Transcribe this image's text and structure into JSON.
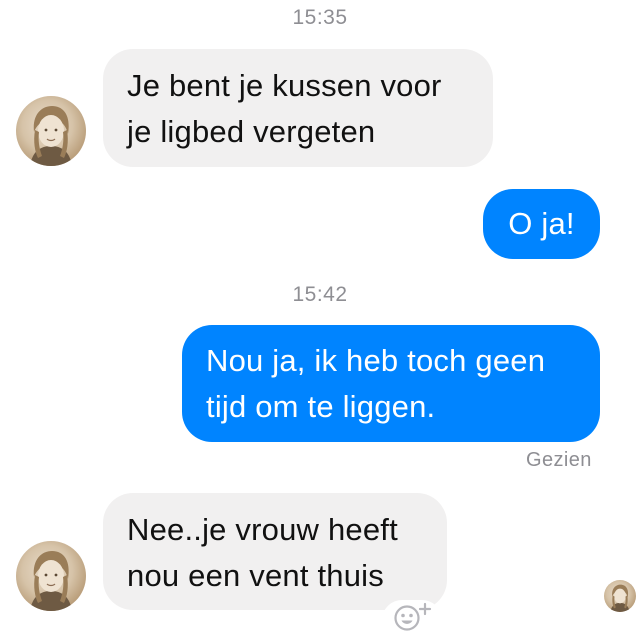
{
  "messages": [
    {
      "type": "timestamp",
      "text": "15:35"
    },
    {
      "type": "incoming",
      "text": "Je bent je kussen voor\nje ligbed vergeten"
    },
    {
      "type": "outgoing",
      "text": "O ja!"
    },
    {
      "type": "timestamp",
      "text": "15:42"
    },
    {
      "type": "outgoing",
      "text": "Nou ja, ik heb toch geen\ntijd om te liggen."
    },
    {
      "type": "incoming",
      "text": "Nee..je vrouw heeft\nnou een vent thuis"
    }
  ],
  "seen_label": "Gezien",
  "icons": {
    "sender_avatar": "contact-avatar-photo",
    "read_receipt": "read-receipt-avatar",
    "reaction": "smiley-plus-icon"
  },
  "colors": {
    "outgoing_bubble": "#0084ff",
    "incoming_bubble": "#f1f0f0",
    "timestamp_text": "#8e8e93"
  }
}
